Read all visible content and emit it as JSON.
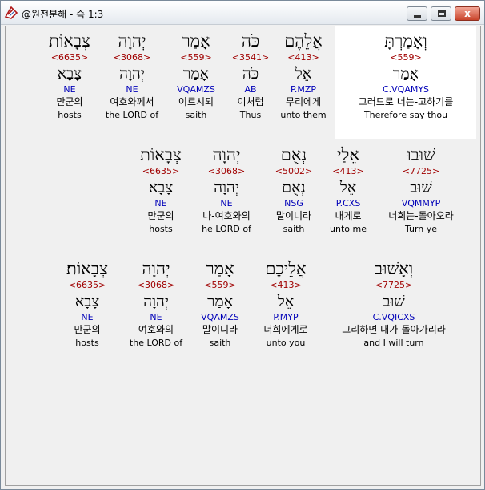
{
  "window": {
    "title": "@원전분해 - 슥 1:3",
    "close_glyph": "x"
  },
  "rows": [
    [
      {
        "vowel": "צְבָאוֹת",
        "strong": "<6635>",
        "root": "צָבָא",
        "parse": "NE",
        "kor": "만군의",
        "eng": "hosts"
      },
      {
        "vowel": "יְהוָה",
        "strong": "<3068>",
        "root": "יְהוָה",
        "parse": "NE",
        "kor": "여호와께서",
        "eng": "the LORD of"
      },
      {
        "vowel": "אָמַר",
        "strong": "<559>",
        "root": "אָמַר",
        "parse": "VQAMZS",
        "kor": "이르시되",
        "eng": "saith"
      },
      {
        "vowel": "כֹּה",
        "strong": "<3541>",
        "root": "כֹּה",
        "parse": "AB",
        "kor": "이처럼",
        "eng": "Thus"
      },
      {
        "vowel": "אֲלֵהֶם",
        "strong": "<413>",
        "root": "אֵל",
        "parse": "P.MZP",
        "kor": "무리에게",
        "eng": "unto them"
      },
      {
        "vowel": "וְאָמַרְתָּ",
        "strong": "<559>",
        "root": "אָמַר",
        "parse": "C.VQAMYS",
        "kor": "그러므로 너는-고하기를",
        "eng": "Therefore say thou"
      }
    ],
    [
      {
        "vowel": "צְבָאוֹת",
        "strong": "<6635>",
        "root": "צָבָא",
        "parse": "NE",
        "kor": "만군의",
        "eng": "hosts"
      },
      {
        "vowel": "יְהוָה",
        "strong": "<3068>",
        "root": "יְהוָה",
        "parse": "NE",
        "kor": "나-여호와의",
        "eng": "he LORD of"
      },
      {
        "vowel": "נְאֻם",
        "strong": "<5002>",
        "root": "נְאֻם",
        "parse": "NSG",
        "kor": "말이니라",
        "eng": "saith"
      },
      {
        "vowel": "אֵלַי",
        "strong": "<413>",
        "root": "אֵל",
        "parse": "P.CXS",
        "kor": "내게로",
        "eng": "unto me"
      },
      {
        "vowel": "שׁוּבוּ",
        "strong": "<7725>",
        "root": "שׁוּב",
        "parse": "VQMMYP",
        "kor": "너희는-돌아오라",
        "eng": "Turn ye"
      }
    ],
    [
      {
        "vowel": "צְבָאוֹת׃",
        "strong": "<6635>",
        "root": "צָבָא",
        "parse": "NE",
        "kor": "만군의",
        "eng": "hosts"
      },
      {
        "vowel": "יְהוָה",
        "strong": "<3068>",
        "root": "יְהוָה",
        "parse": "NE",
        "kor": "여호와의",
        "eng": "the LORD of"
      },
      {
        "vowel": "אָמַר",
        "strong": "<559>",
        "root": "אָמַר",
        "parse": "VQAMZS",
        "kor": "말이니라",
        "eng": "saith"
      },
      {
        "vowel": "אֲלֵיכֶם",
        "strong": "<413>",
        "root": "אֵל",
        "parse": "P.MYP",
        "kor": "너희에게로",
        "eng": "unto you"
      },
      {
        "vowel": "וְאָשׁוּב",
        "strong": "<7725>",
        "root": "שׁוּב",
        "parse": "C.VQICXS",
        "kor": "그리하면 내가-돌아가리라",
        "eng": "and I will turn"
      }
    ]
  ]
}
